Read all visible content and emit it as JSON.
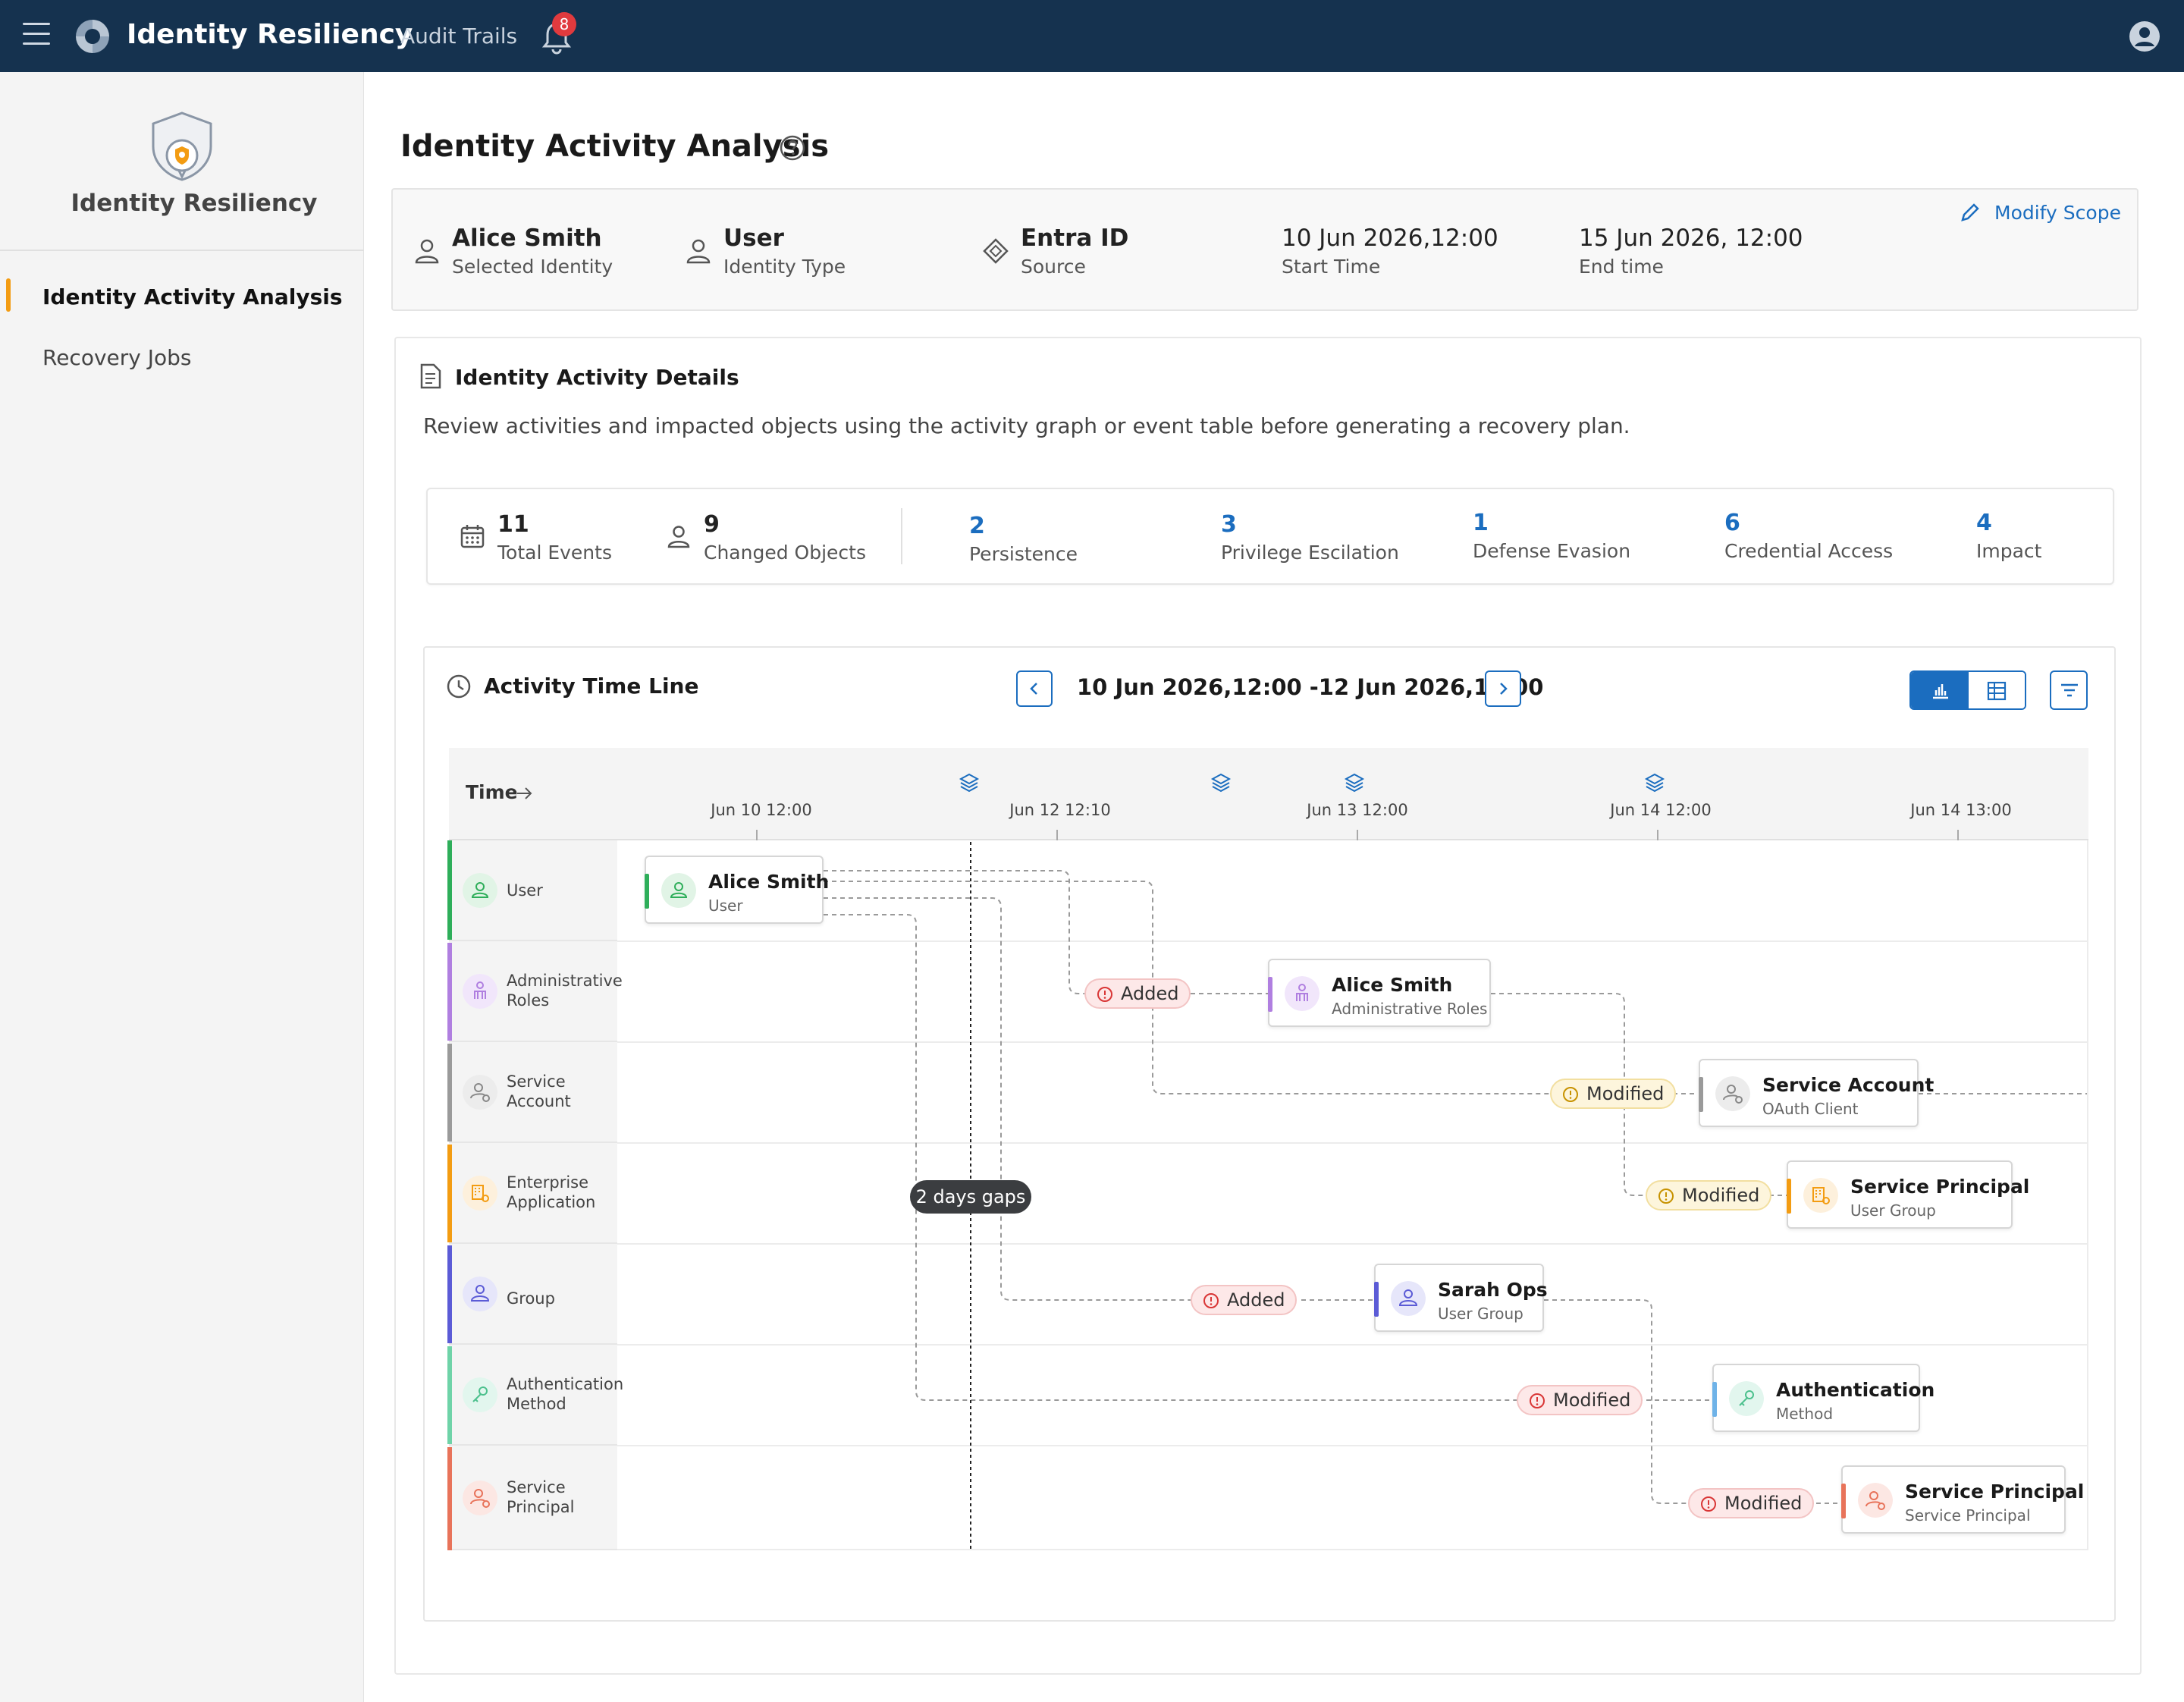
{
  "topbar": {
    "app_title": "Identity Resiliency",
    "nav_link": "Audit Trails",
    "notification_count": "8"
  },
  "sidebar": {
    "title": "Identity Resiliency",
    "items": [
      {
        "label": "Identity Activity Analysis",
        "active": true
      },
      {
        "label": "Recovery Jobs",
        "active": false
      }
    ]
  },
  "page": {
    "title": "Identity Activity Analysis"
  },
  "scope": {
    "identity": {
      "value": "Alice Smith",
      "label": "Selected Identity"
    },
    "type": {
      "value": "User",
      "label": "Identity Type"
    },
    "source": {
      "value": "Entra ID",
      "label": "Source"
    },
    "start": {
      "value": "10 Jun 2026,12:00",
      "label": "Start Time"
    },
    "end": {
      "value": "15 Jun 2026, 12:00",
      "label": "End time"
    },
    "modify_label": "Modify Scope"
  },
  "details": {
    "title": "Identity Activity Details",
    "description": "Review activities and impacted objects using the activity graph or event table before generating a recovery plan."
  },
  "stats": {
    "total_events": {
      "value": "11",
      "label": "Total Events"
    },
    "changed_objects": {
      "value": "9",
      "label": "Changed Objects"
    },
    "tactics": [
      {
        "value": "2",
        "label": "Persistence"
      },
      {
        "value": "3",
        "label": "Privilege Escilation"
      },
      {
        "value": "1",
        "label": "Defense Evasion"
      },
      {
        "value": "6",
        "label": "Credential Access"
      },
      {
        "value": "4",
        "label": "Impact"
      }
    ]
  },
  "timeline": {
    "title": "Activity Time Line",
    "range": "10 Jun 2026,12:00 -12 Jun 2026,12:00",
    "time_header": "Time",
    "ticks": [
      "Jun 10 12:00",
      "Jun 12 12:10",
      "Jun 13 12:00",
      "Jun 14 12:00",
      "Jun 14 13:00"
    ],
    "gap_label": "2 days gaps",
    "rows": [
      {
        "label1": "User",
        "label2": "",
        "color": "#2eae5a"
      },
      {
        "label1": "Administrative",
        "label2": "Roles",
        "color": "#b07fe0"
      },
      {
        "label1": "Service",
        "label2": "Account",
        "color": "#9a9a9a"
      },
      {
        "label1": "Enterprise",
        "label2": "Application",
        "color": "#f39c12"
      },
      {
        "label1": "Group",
        "label2": "",
        "color": "#5b5bd6"
      },
      {
        "label1": "Authentication",
        "label2": "Method",
        "color": "#6fd3a8"
      },
      {
        "label1": "Service",
        "label2": "Principal",
        "color": "#e8735a"
      }
    ],
    "nodes": [
      {
        "title": "Alice Smith",
        "sub": "User"
      },
      {
        "title": "Alice Smith",
        "sub": "Administrative Roles"
      },
      {
        "title": "Service Account",
        "sub": "OAuth Client"
      },
      {
        "title": "Service Principal",
        "sub": "User Group"
      },
      {
        "title": "Sarah Ops",
        "sub": "User Group"
      },
      {
        "title": "Authentication",
        "sub": "Method"
      },
      {
        "title": "Service Principal",
        "sub": "Service Principal"
      }
    ],
    "pills": [
      {
        "label": "Added"
      },
      {
        "label": "Modified"
      },
      {
        "label": "Modified"
      },
      {
        "label": "Added"
      },
      {
        "label": "Modified"
      },
      {
        "label": "Modified"
      }
    ]
  },
  "colors": {
    "topbar": "#15324f",
    "accent": "#1b6dbf",
    "active_indicator": "#f39c12"
  }
}
